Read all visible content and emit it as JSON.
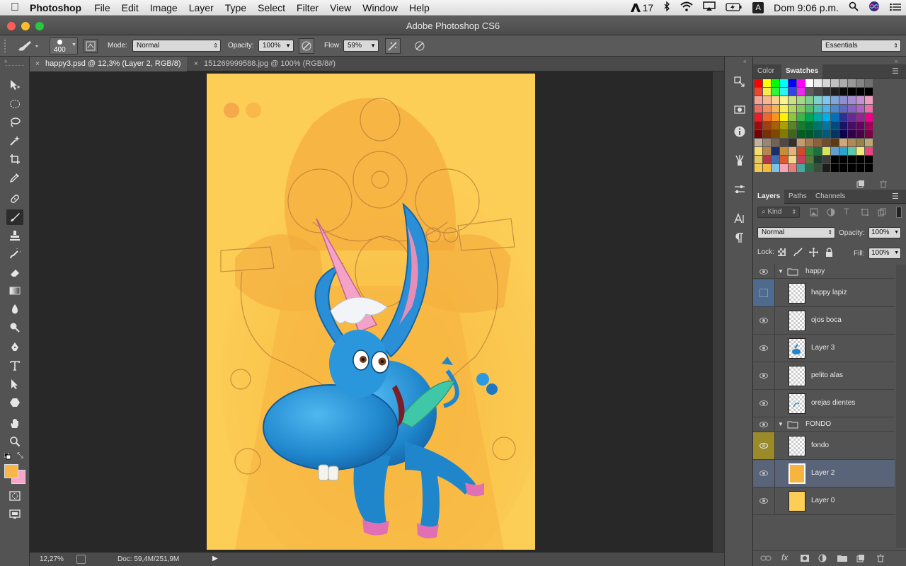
{
  "menubar": {
    "app_name": "Photoshop",
    "items": [
      "File",
      "Edit",
      "Image",
      "Layer",
      "Type",
      "Select",
      "Filter",
      "View",
      "Window",
      "Help"
    ],
    "adobe_badge": "17",
    "clock": "Dom 9:06 p.m.",
    "input_source": "A"
  },
  "window": {
    "title": "Adobe Photoshop CS6"
  },
  "options_bar": {
    "brush_size": "400",
    "mode_label": "Mode:",
    "mode_value": "Normal",
    "opacity_label": "Opacity:",
    "opacity_value": "100%",
    "flow_label": "Flow:",
    "flow_value": "59%",
    "workspace": "Essentials"
  },
  "tabs": [
    {
      "label": "happy3.psd @ 12,3% (Layer 2, RGB/8)",
      "close": "×"
    },
    {
      "label": "151269999588.jpg @ 100% (RGB/8#)",
      "close": "×"
    }
  ],
  "status": {
    "zoom": "12,27%",
    "doc": "Doc: 59,4M/251,9M"
  },
  "color_panel": {
    "tabs": [
      "Color",
      "Swatches"
    ],
    "swatch_rows": [
      [
        "#ff0000",
        "#ffff00",
        "#00ff00",
        "#00ffff",
        "#0000ff",
        "#ff00ff",
        "#ffffff",
        "#ebebeb",
        "#d6d6d6",
        "#c2c2c2",
        "#adadad",
        "#999999",
        "#858585",
        "#707070"
      ],
      [
        "#f0432b",
        "#f7ec4a",
        "#2ff53a",
        "#2af5f2",
        "#2f45e9",
        "#e82af0",
        "#5c5c5c",
        "#474747",
        "#333333",
        "#1f1f1f",
        "#0a0a0a",
        "#000000",
        "#000000",
        "#000000"
      ],
      [
        "#f4a196",
        "#f7b690",
        "#f9d18c",
        "#fcf48c",
        "#cde37f",
        "#a6d985",
        "#7fd08e",
        "#7dd3c8",
        "#7ec8f0",
        "#7fa6dd",
        "#8d90d0",
        "#a58ed0",
        "#c590d2",
        "#f09cc0"
      ],
      [
        "#ee6b5d",
        "#f48e5a",
        "#f7b559",
        "#faef58",
        "#b4d85a",
        "#83c960",
        "#4fbd6c",
        "#4dbfb2",
        "#4ab3ea",
        "#4f88d0",
        "#6068c0",
        "#8464c0",
        "#b063c2",
        "#eb6ea6"
      ],
      [
        "#eb1c24",
        "#f1662a",
        "#f7941d",
        "#fff200",
        "#8dc63f",
        "#39b54a",
        "#00a651",
        "#00a99d",
        "#00aeef",
        "#0072bc",
        "#2e3192",
        "#662d91",
        "#92278f",
        "#ec008c"
      ],
      [
        "#9e0b0f",
        "#a0410d",
        "#a36209",
        "#aba000",
        "#598527",
        "#197b30",
        "#007236",
        "#00746b",
        "#0076a3",
        "#004a80",
        "#1b1464",
        "#440e62",
        "#630460",
        "#9e005d"
      ],
      [
        "#790000",
        "#7b2e00",
        "#7d4900",
        "#827b00",
        "#406618",
        "#005e20",
        "#005826",
        "#005952",
        "#005b7f",
        "#003663",
        "#0d004c",
        "#32004b",
        "#4b0049",
        "#7b0046"
      ],
      [
        "#c7b299",
        "#998675",
        "#736357",
        "#534741",
        "#37302a",
        "#c69c6d",
        "#a67c52",
        "#8c6239",
        "#754c24",
        "#603913",
        "#d0a77b",
        "#b08956",
        "#998245",
        "#bda874"
      ],
      [
        "#f5dc6b",
        "#b5874e",
        "#1b2f6b",
        "#c98d3a",
        "#e3b37a",
        "#d6472f",
        "#3a8a3d",
        "#1f6e3f",
        "#d9e35a",
        "#5f9fd1",
        "#2aa4c9",
        "#5dc8a8",
        "#f3e87a",
        "#e8447d"
      ],
      [
        "#e8c85a",
        "#b7354a",
        "#3b6fb0",
        "#e05a2b",
        "#f2d98a",
        "#c7415c",
        "#5a7a3a",
        "#1c3c2c",
        "#3c3c3c",
        "#000000",
        "#000000",
        "#000000",
        "#000000",
        "#000000"
      ],
      [
        "#f2c94c",
        "#f4ba3a",
        "#7ec2ea",
        "#f6a6b3",
        "#eb7b7b",
        "#4ca6a0",
        "#2d6e4d",
        "#3a4f3a",
        "#1c1c1c",
        "#000000",
        "#000000",
        "#000000",
        "#000000",
        "#000000"
      ]
    ]
  },
  "layers_panel": {
    "tabs": [
      "Layers",
      "Paths",
      "Channels"
    ],
    "kind_label": "Kind",
    "blend_mode": "Normal",
    "opacity_label": "Opacity:",
    "opacity_value": "100%",
    "lock_label": "Lock:",
    "fill_label": "Fill:",
    "fill_value": "100%",
    "rows": [
      {
        "type": "group",
        "name": "happy",
        "visible": true
      },
      {
        "type": "layer",
        "name": "happy lapiz",
        "visible": false
      },
      {
        "type": "layer",
        "name": "ojos boca",
        "visible": true
      },
      {
        "type": "layer",
        "name": "Layer 3",
        "visible": true
      },
      {
        "type": "layer",
        "name": "pelito alas",
        "visible": true
      },
      {
        "type": "layer",
        "name": "orejas dientes",
        "visible": true
      },
      {
        "type": "group",
        "name": "FONDO",
        "visible": true
      },
      {
        "type": "layer",
        "name": "fondo",
        "visible": true
      },
      {
        "type": "layer",
        "name": "Layer 2",
        "visible": true
      },
      {
        "type": "layer",
        "name": "Layer 0",
        "visible": true
      }
    ]
  },
  "colors": {
    "foreground": "#f7b54a",
    "background": "#f6a6c8",
    "canvas_bg": "#fbc84a",
    "selected_layer": "#5a6478",
    "fondo_eye_bg": "#9a8a2a"
  }
}
